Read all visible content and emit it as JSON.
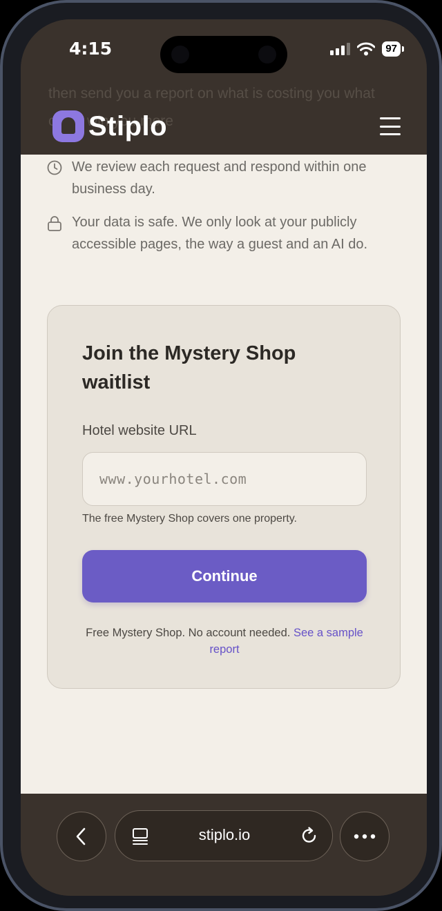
{
  "status_bar": {
    "time": "4:15",
    "battery": "97"
  },
  "header": {
    "brand": "Stiplo",
    "ghost_text": "then send you a report on what is costing you what could win you more"
  },
  "info_items": [
    {
      "icon": "clock-icon",
      "text": "We review each request and respond within one business day."
    },
    {
      "icon": "lock-icon",
      "text": "Your data is safe. We only look at your publicly accessible pages, the way a guest and an AI do."
    }
  ],
  "form": {
    "title": "Join the Mystery Shop waitlist",
    "url_label": "Hotel website URL",
    "url_placeholder": "www.yourhotel.com",
    "url_value": "",
    "helper": "The free Mystery Shop covers one property.",
    "submit_label": "Continue",
    "footnote_text": "Free Mystery Shop. No account needed. ",
    "footnote_link": "See a sample report"
  },
  "browser_bar": {
    "url": "stiplo.io"
  },
  "colors": {
    "accent": "#6b5cc5",
    "header_bg": "#3a322c",
    "page_bg": "#f3efe8",
    "card_bg": "#e8e3da"
  }
}
